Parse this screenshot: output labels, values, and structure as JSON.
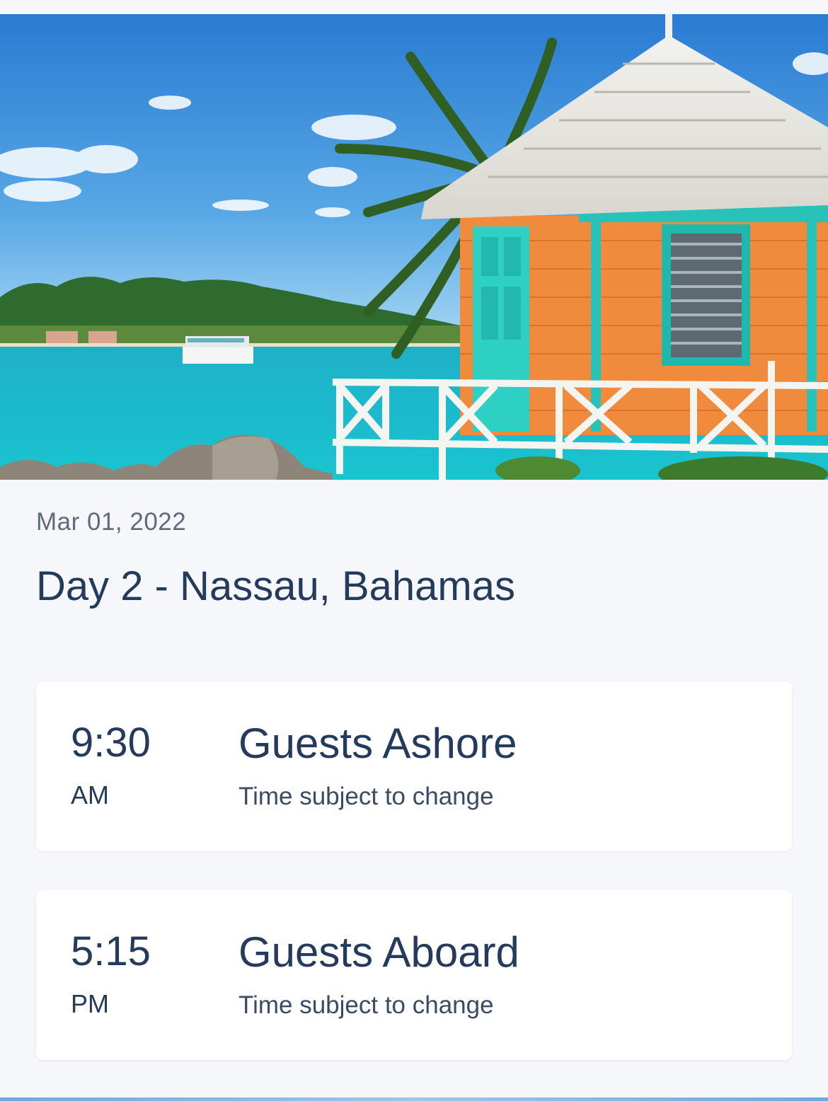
{
  "hero": {
    "image_icon": "bahamas-beach-hut-photo"
  },
  "itinerary": {
    "date": "Mar 01, 2022",
    "day_title": "Day 2 - Nassau, Bahamas",
    "events": [
      {
        "time": "9:30",
        "period": "AM",
        "title": "Guests Ashore",
        "note": "Time subject to change"
      },
      {
        "time": "5:15",
        "period": "PM",
        "title": "Guests Aboard",
        "note": "Time subject to change"
      }
    ]
  },
  "colors": {
    "background": "#f5f7fb",
    "text_primary": "#253b5c",
    "text_secondary": "#5f6b7c",
    "card": "#ffffff"
  }
}
